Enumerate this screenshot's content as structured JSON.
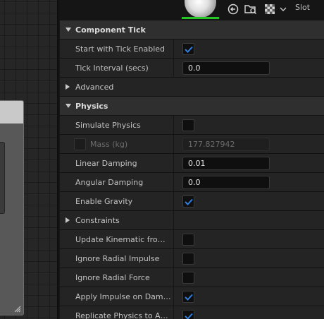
{
  "toolbar": {
    "slot_label": "Slot",
    "accent_green": "#26c326"
  },
  "categories": {
    "component_tick": "Component Tick",
    "advanced": "Advanced",
    "physics": "Physics",
    "constraints": "Constraints"
  },
  "tick": {
    "start_with_tick_enabled": {
      "label": "Start with Tick Enabled",
      "checked": true
    },
    "tick_interval": {
      "label": "Tick Interval (secs)",
      "value": "0.0"
    }
  },
  "physics": {
    "simulate_physics": {
      "label": "Simulate Physics",
      "checked": false
    },
    "mass": {
      "label": "Mass (kg)",
      "value": "177.827942",
      "enabled": false
    },
    "linear_damping": {
      "label": "Linear Damping",
      "value": "0.01"
    },
    "angular_damping": {
      "label": "Angular Damping",
      "value": "0.0"
    },
    "enable_gravity": {
      "label": "Enable Gravity",
      "checked": true
    },
    "update_kinematic": {
      "label": "Update Kinematic from Simulation",
      "checked": false
    },
    "ignore_radial_impulse": {
      "label": "Ignore Radial Impulse",
      "checked": false
    },
    "ignore_radial_force": {
      "label": "Ignore Radial Force",
      "checked": false
    },
    "apply_impulse_on_damage": {
      "label": "Apply Impulse on Damage",
      "checked": true
    },
    "replicate_physics": {
      "label": "Replicate Physics to Autonomous Proxy",
      "checked": true
    }
  },
  "colors": {
    "check_blue": "#2f7fe0"
  }
}
